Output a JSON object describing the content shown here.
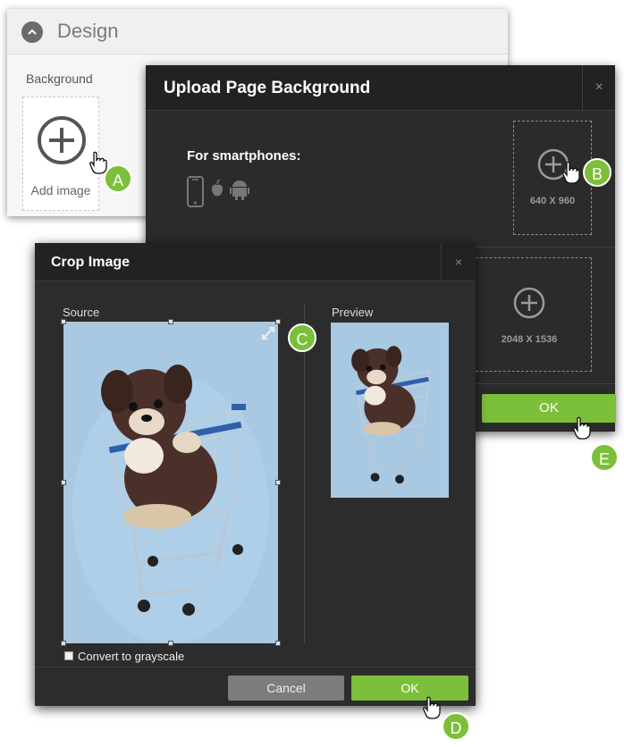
{
  "design_panel": {
    "title": "Design",
    "background_label": "Background",
    "add_image_label": "Add image"
  },
  "upload_dialog": {
    "title": "Upload Page Background",
    "close_glyph": "×",
    "smartphones_label": "For smartphones:",
    "resolution_1": "640 X 960",
    "resolution_2": "2048 X 1536",
    "ok_label": "OK"
  },
  "crop_dialog": {
    "title": "Crop Image",
    "close_glyph": "×",
    "source_label": "Source",
    "preview_label": "Preview",
    "grayscale_label": "Convert to grayscale",
    "cancel_label": "Cancel",
    "ok_label": "OK"
  },
  "markers": {
    "a": "A",
    "b": "B",
    "c": "C",
    "d": "D",
    "e": "E"
  },
  "colors": {
    "accent_green": "#7cbf3a",
    "dialog_bg": "#2b2b2b",
    "image_bg": "#a9c9e3"
  },
  "icons": {
    "design_toggle": "chevron-up-icon",
    "add": "plus-circle-icon",
    "devices": [
      "smartphone-icon",
      "apple-icon",
      "android-icon"
    ],
    "resize": "expand-icon",
    "pointer": "hand-cursor-icon"
  }
}
